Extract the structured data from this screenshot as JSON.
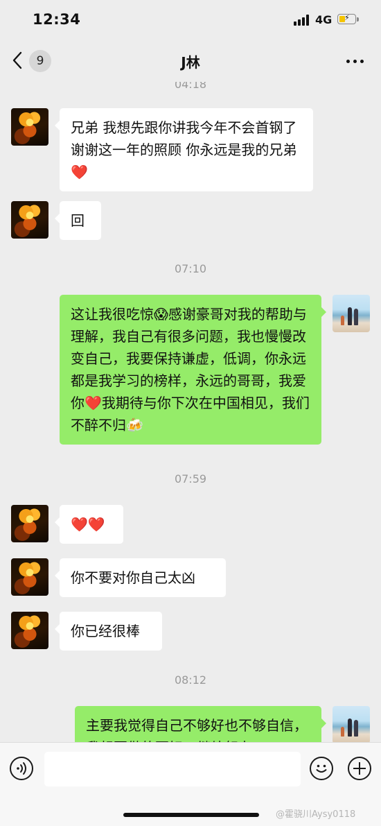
{
  "status_bar": {
    "time": "12:34",
    "network": "4G"
  },
  "nav": {
    "unread_count": "9",
    "title": "J林"
  },
  "messages": [
    {
      "kind": "time",
      "text": "04:18"
    },
    {
      "kind": "msg",
      "side": "in",
      "text": "兄弟 我想先跟你讲我今年不会首钢了 谢谢这一年的照顾 你永远是我的兄弟 ❤️"
    },
    {
      "kind": "msg",
      "side": "in",
      "text": "回"
    },
    {
      "kind": "time",
      "text": "07:10"
    },
    {
      "kind": "msg",
      "side": "out",
      "text": "这让我很吃惊😱感谢豪哥对我的帮助与理解，我自己有很多问题，我也慢慢改变自己，我要保持谦虚，低调，你永远都是我学习的榜样，永远的哥哥，我爱你❤️我期待与你下次在中国相见，我们不醉不归🍻"
    },
    {
      "kind": "time",
      "text": "07:59"
    },
    {
      "kind": "msg",
      "side": "in",
      "text": "❤️❤️"
    },
    {
      "kind": "msg",
      "side": "in",
      "text": "你不要对你自己太凶"
    },
    {
      "kind": "msg",
      "side": "in",
      "text": "你已经很棒"
    },
    {
      "kind": "time",
      "text": "08:12"
    },
    {
      "kind": "msg",
      "side": "out",
      "text": "主要我觉得自己不够好也不够自信，我想要做的更好，继续努力"
    }
  ],
  "input_bar": {
    "placeholder": ""
  },
  "watermark": "@霍骁川Aysy0118"
}
